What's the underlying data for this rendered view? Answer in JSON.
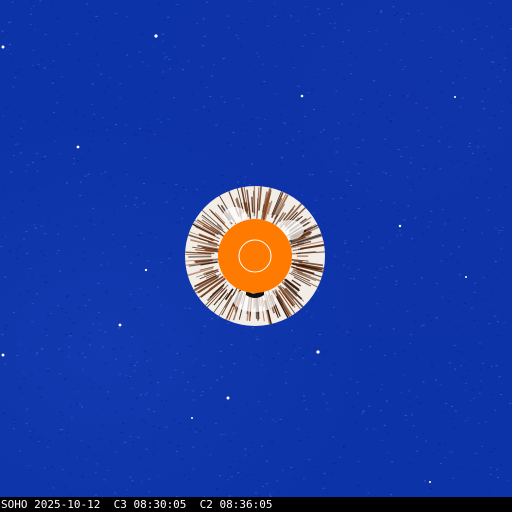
{
  "image": {
    "caption": "SOHO 2025-10-12  C3 08:30:05  C2 08:36:05"
  },
  "colors": {
    "background": "#0d33a8",
    "occulter": "#ff7a00",
    "sun_outline": "#ffffff",
    "caption_bar": "#000000",
    "caption_text": "#ffffff"
  }
}
